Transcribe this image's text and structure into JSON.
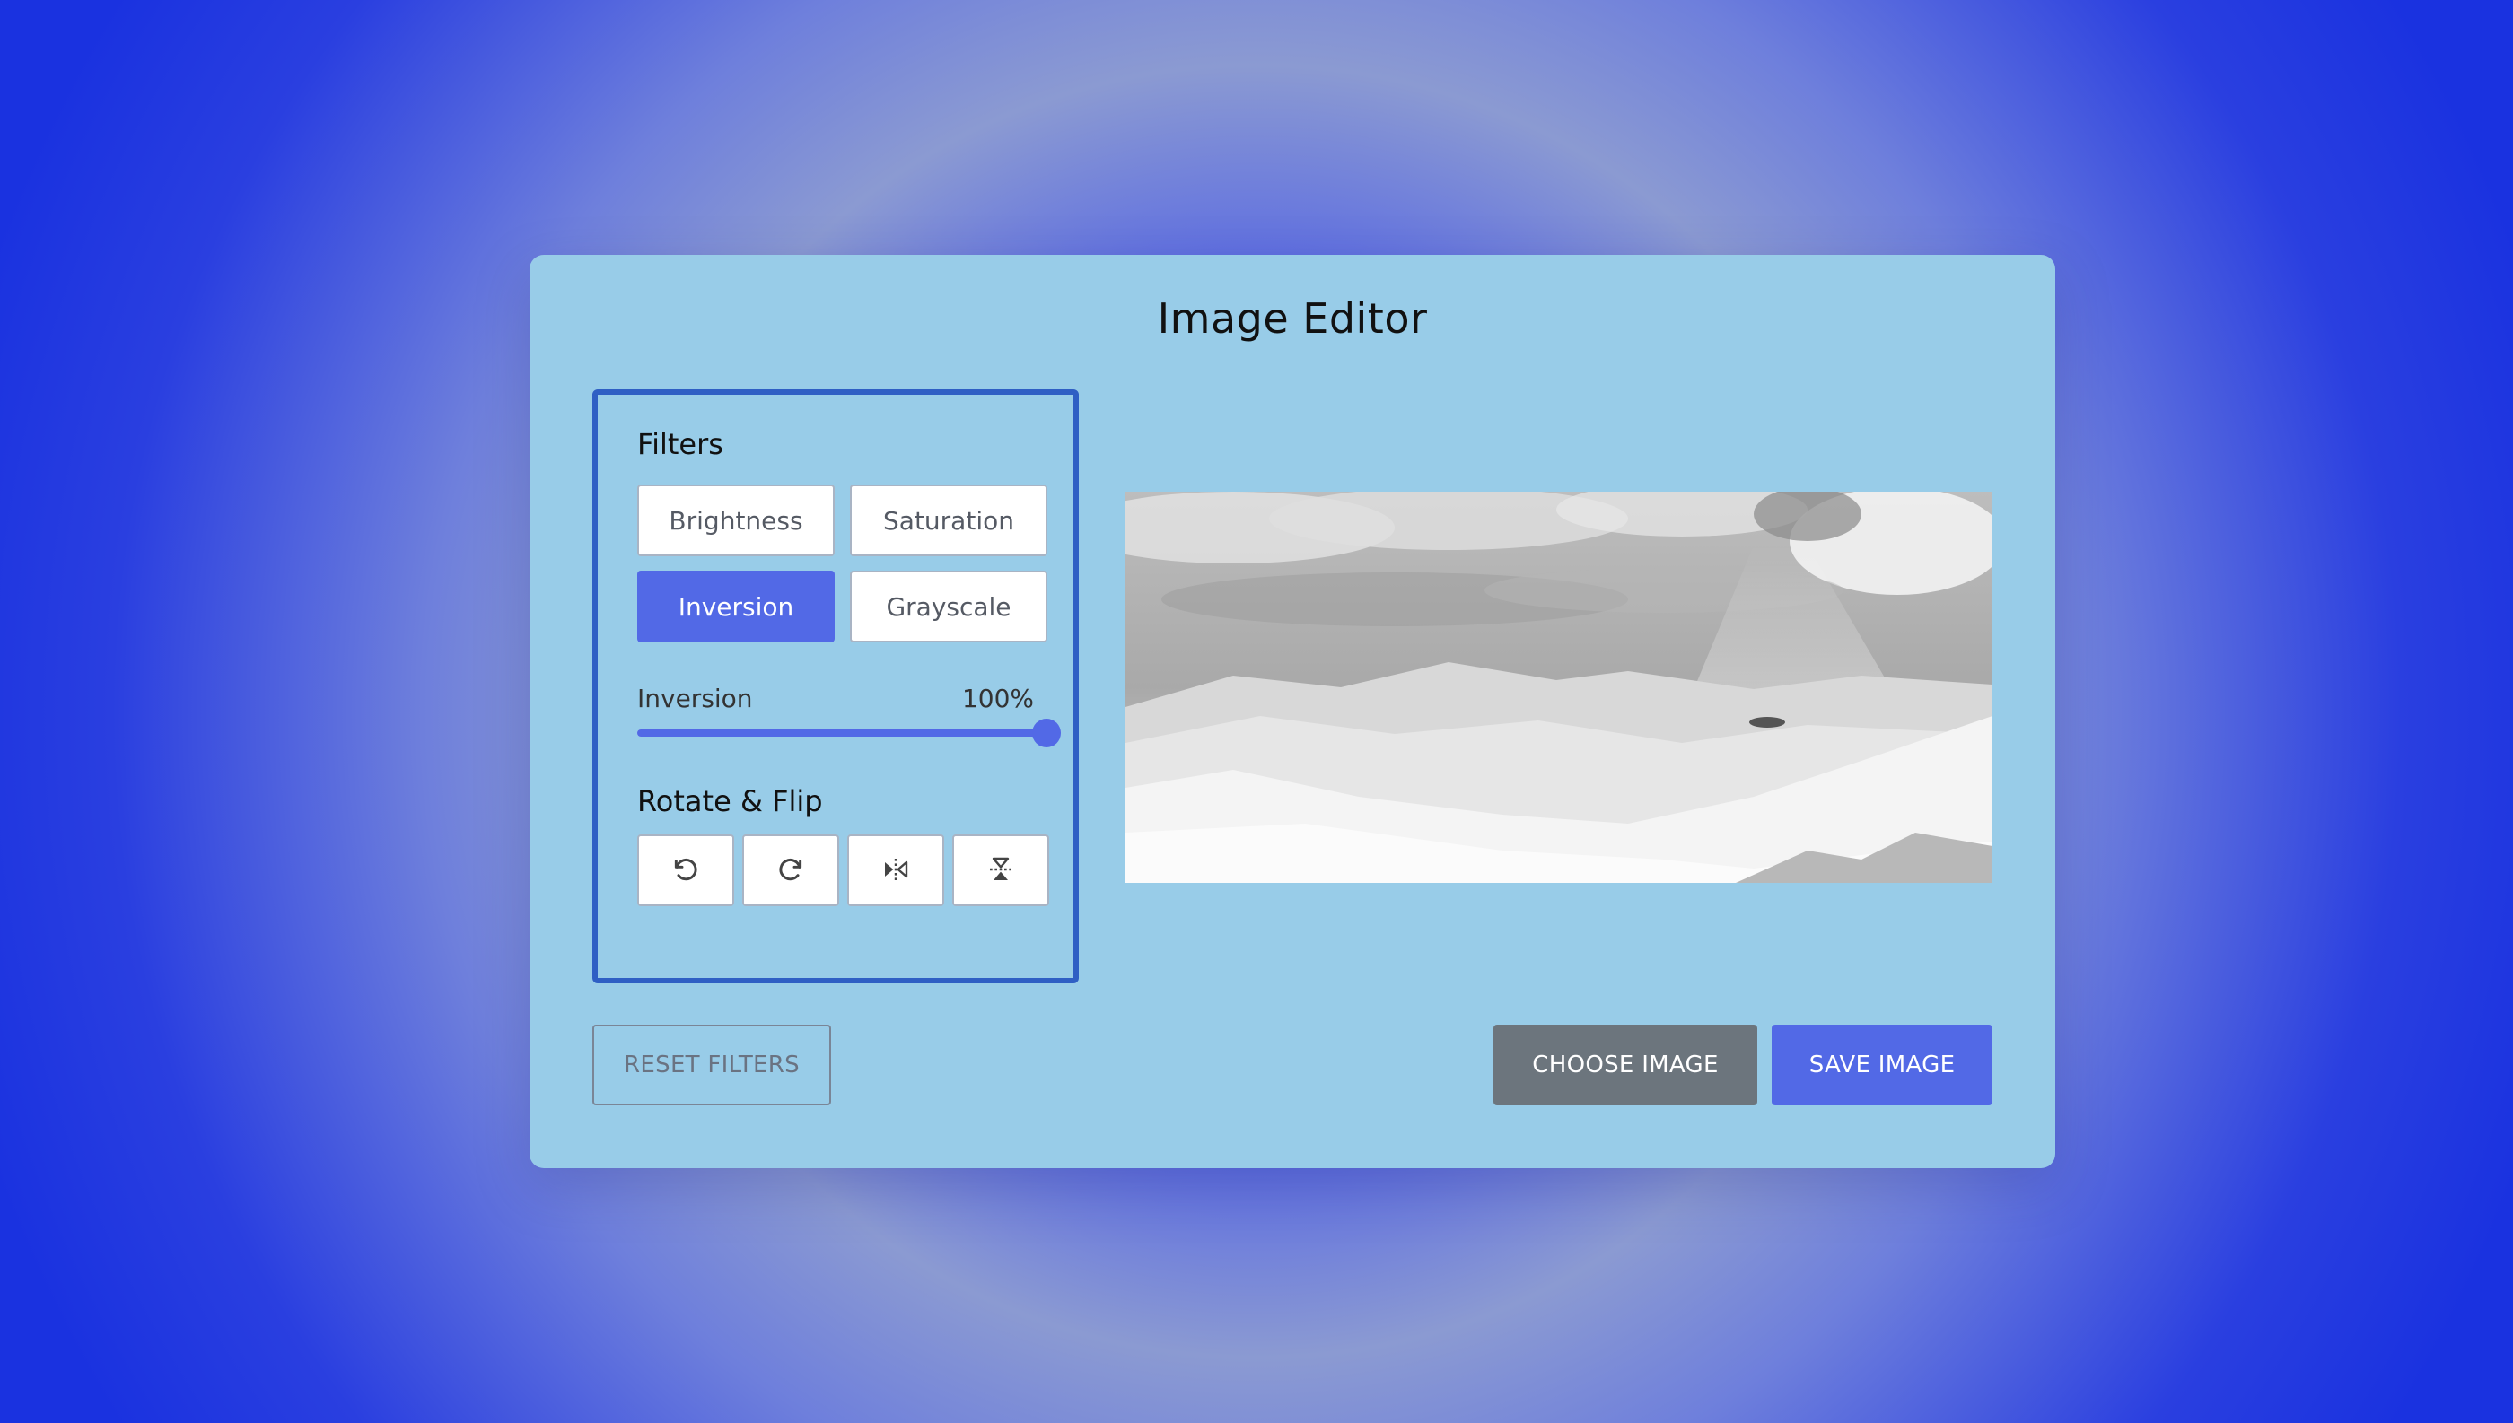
{
  "app": {
    "title": "Image Editor"
  },
  "filters": {
    "heading": "Filters",
    "options": [
      {
        "label": "Brightness",
        "active": false
      },
      {
        "label": "Saturation",
        "active": false
      },
      {
        "label": "Inversion",
        "active": true
      },
      {
        "label": "Grayscale",
        "active": false
      }
    ],
    "slider": {
      "name": "Inversion",
      "value_text": "100%",
      "value": 100,
      "max": 100
    }
  },
  "rotate_flip": {
    "heading": "Rotate & Flip",
    "buttons": [
      {
        "icon": "rotate-left-icon"
      },
      {
        "icon": "rotate-right-icon"
      },
      {
        "icon": "flip-horizontal-icon"
      },
      {
        "icon": "flip-vertical-icon"
      }
    ]
  },
  "preview": {
    "filter": "inverted landscape, grayscale appearance"
  },
  "actions": {
    "reset_label": "RESET FILTERS",
    "choose_label": "CHOOSE IMAGE",
    "save_label": "SAVE IMAGE"
  },
  "colors": {
    "accent": "#5269e6",
    "card_bg": "#98cce8",
    "panel_border": "#2f5fc4",
    "choose_bg": "#6c757d"
  }
}
